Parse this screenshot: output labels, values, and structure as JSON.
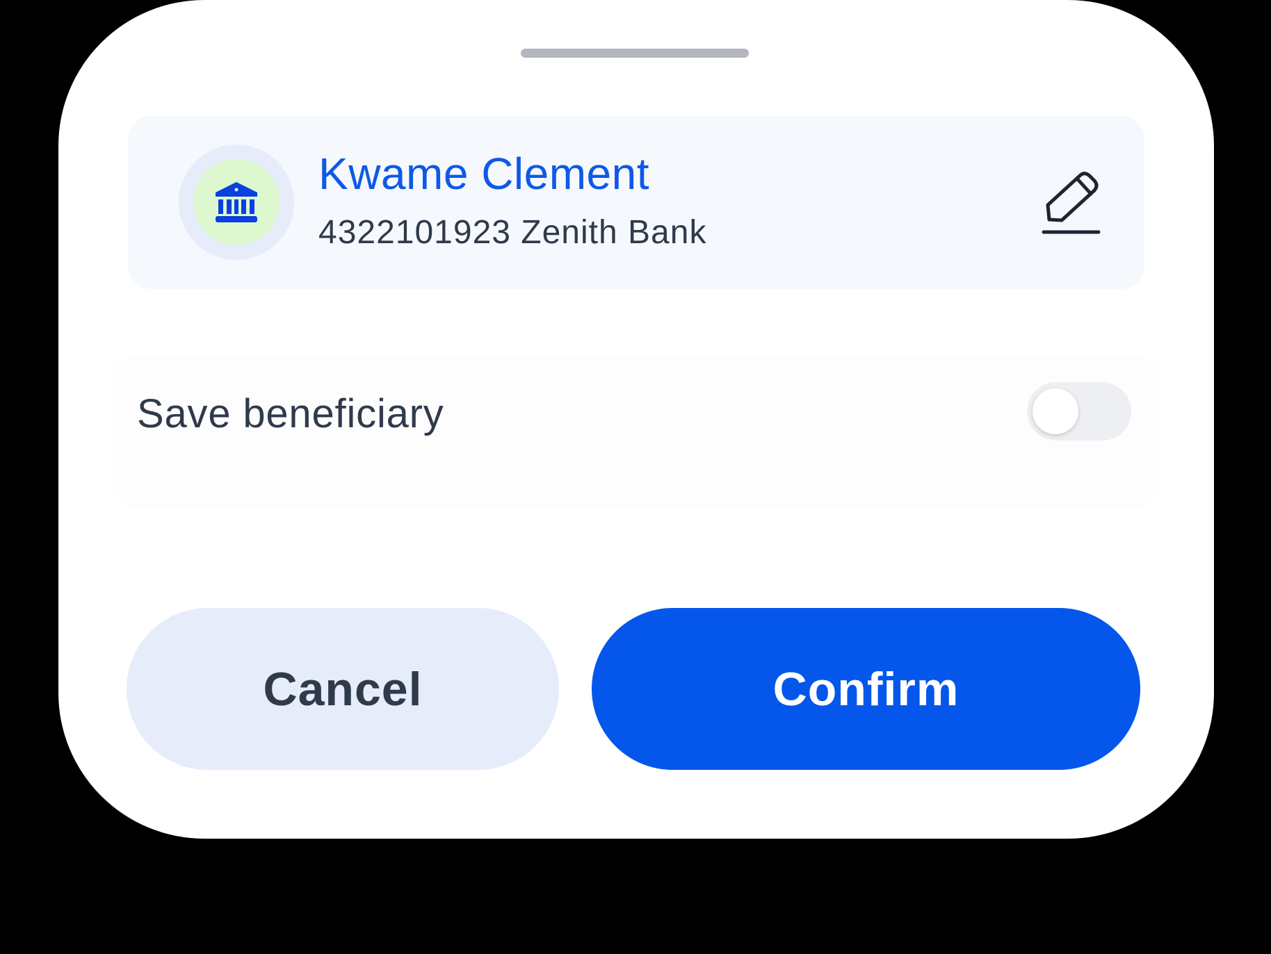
{
  "sheet": {
    "beneficiary": {
      "name": "Kwame Clement",
      "account_details": "4322101923 Zenith Bank",
      "icon": "bank-icon",
      "edit_icon": "edit-pencil-icon"
    },
    "save_beneficiary": {
      "label": "Save beneficiary",
      "enabled": false
    },
    "actions": {
      "cancel_label": "Cancel",
      "confirm_label": "Confirm"
    }
  },
  "colors": {
    "accent": "#0457ea",
    "name_text": "#0e59e6",
    "body_text": "#2f3a4b",
    "avatar_bg": "#ddf7cf",
    "cancel_bg": "#e6ecfa"
  }
}
